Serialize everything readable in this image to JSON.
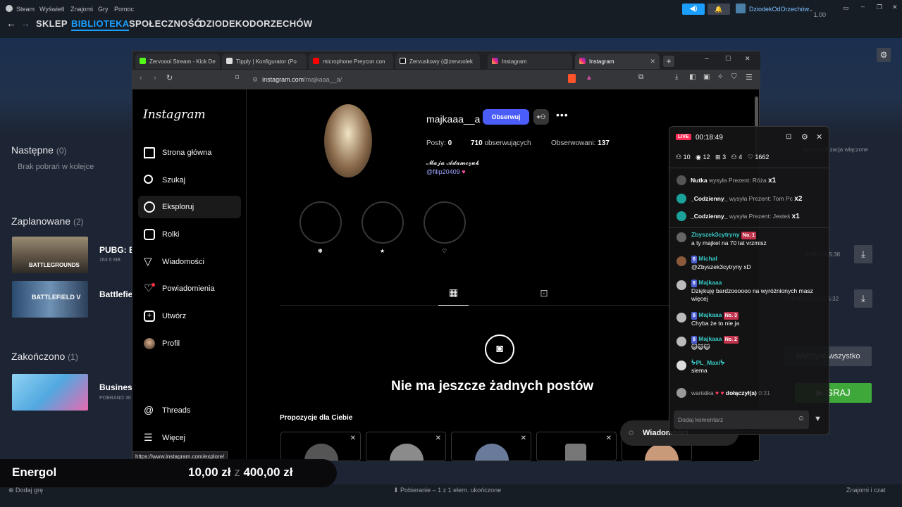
{
  "steam": {
    "menu": [
      "Steam",
      "Wyświetl",
      "Znajomi",
      "Gry",
      "Pomoc"
    ],
    "nav": [
      "SKLEP",
      "BIBLIOTEKA",
      "SPOŁECZNOŚĆ",
      "DZIODEKODORZECHÓW"
    ],
    "user": "DziodekOdOrzechów",
    "balance": "1,00 zł",
    "next_title": "Następne",
    "next_count": "(0)",
    "next_empty": "Brak pobrań w kolejce",
    "scheduled_title": "Zaplanowane",
    "scheduled_count": "(2)",
    "scheduled": [
      {
        "name": "PUBG: B",
        "size": "163.5 MB",
        "thumb_text": "BATTLEGROUNDS",
        "when": "SOBOTA 5:38"
      },
      {
        "name": "Battlefie",
        "size": "",
        "thumb_text": "BATTLEFIELD V",
        "when": "PONIEDZIAŁEK 5:32"
      }
    ],
    "completed_title": "Zakończono",
    "completed_count": "(1)",
    "completed": [
      {
        "name": "Business",
        "sub": "POBRANO 30"
      }
    ],
    "auto_update": "Autoaktualizacja włączone",
    "clear_all": "Wyczyść wszystko",
    "play": "GRAJ",
    "add_game": "Dodaj grę",
    "download_status": "Pobieranie – 1 z 1 elem. ukończone",
    "friends_chat": "Znajomi i czat",
    "hover_url": "https://www.instagram.com/explore/"
  },
  "browser": {
    "tabs": [
      {
        "label": "Zervoool Stream - Kick De",
        "color": "#53fc18"
      },
      {
        "label": "Tipply | Konfigurator (Po",
        "color": "#ffffff"
      },
      {
        "label": "microphone Preycon con",
        "color": "#ff0000"
      },
      {
        "label": "Zervuskowy (@zervoolek",
        "color": "#ffffff"
      },
      {
        "label": "Instagram",
        "color": "#e1306c"
      },
      {
        "label": "Instagram",
        "color": "#e1306c"
      }
    ],
    "url_host": "instagram.com",
    "url_path": "/majkaaa__a/"
  },
  "instagram": {
    "logo": "Instagram",
    "nav": [
      "Strona główna",
      "Szukaj",
      "Eksploruj",
      "Rolki",
      "Wiadomości",
      "Powiadomienia",
      "Utwórz",
      "Profil"
    ],
    "nav_bottom": [
      "Threads",
      "Więcej"
    ],
    "icons": [
      "home-icon",
      "search-icon",
      "explore-icon",
      "reels-icon",
      "messages-icon",
      "heart-icon",
      "create-icon",
      "profile-avatar-icon"
    ],
    "username": "majkaaa__a",
    "follow": "Obserwuj",
    "posts_label": "Posty:",
    "posts": "0",
    "followers": "710",
    "followers_label": "obserwujących",
    "following_label": "Obserwowani:",
    "following": "137",
    "fullname": "𝓜𝓪𝓳𝓪 𝓐𝓭𝓪𝓶𝓬𝔃𝓾𝓴",
    "bio_link": "@filip20409",
    "bio_heart": "♥",
    "highlights": [
      "✽",
      "★",
      "♡"
    ],
    "empty_posts": "Nie ma jeszcze żadnych postów",
    "suggestions": "Propozycje dla Ciebie",
    "messages_pill": "Wiadomości"
  },
  "chat": {
    "live": "LIVE",
    "timer": "00:18:49",
    "stats": [
      "10",
      "12",
      "3",
      "4",
      "1662"
    ],
    "gifts": [
      {
        "user": "Nutka",
        "text": "wysyła Prezent: Róża",
        "mult": "x1",
        "av": "#555"
      },
      {
        "user": "_Codzienny_",
        "text": "wysyła Prezent: Tom Pc",
        "mult": "x2",
        "av": "#1ba29a"
      },
      {
        "user": "_Codzienny_",
        "text": "wysyła Prezent: Jesteś",
        "mult": "x1",
        "av": "#1ba29a"
      }
    ],
    "messages": [
      {
        "user": "Zbyszek3cytryny",
        "badge": "",
        "rank": "No. 1",
        "text": "a ty majkel na 70 lat vrzmisz",
        "av": "#666"
      },
      {
        "user": "Michał",
        "badge": "6",
        "rank": "",
        "text": "@Zbyszek3cytryny xD",
        "av": "#8a5a3a"
      },
      {
        "user": "Majkaaa",
        "badge": "8",
        "rank": "",
        "text": "Dziękuję bardzoooooo na wyróżnionych masz więcej",
        "av": "#bbb"
      },
      {
        "user": "Majkaaa",
        "badge": "8",
        "rank": "No. 3",
        "text": "Chyba że to nie ja",
        "av": "#bbb"
      },
      {
        "user": "Majkaaa",
        "badge": "8",
        "rank": "No. 2",
        "text": "😺😺😺",
        "av": "#bbb"
      },
      {
        "user": "ᖭPL_Maxiᖭ",
        "badge": "",
        "rank": "",
        "text": "siema",
        "av": "#ddd"
      }
    ],
    "join": {
      "user": "wariatka",
      "text": "dołączył(a)",
      "time": "0:31"
    },
    "placeholder": "Dodaj komentarz"
  },
  "energol": {
    "name": "Energol",
    "amount": "10,00 zł",
    "sep": "z",
    "goal": "400,00 zł",
    "progress": 0.025
  }
}
